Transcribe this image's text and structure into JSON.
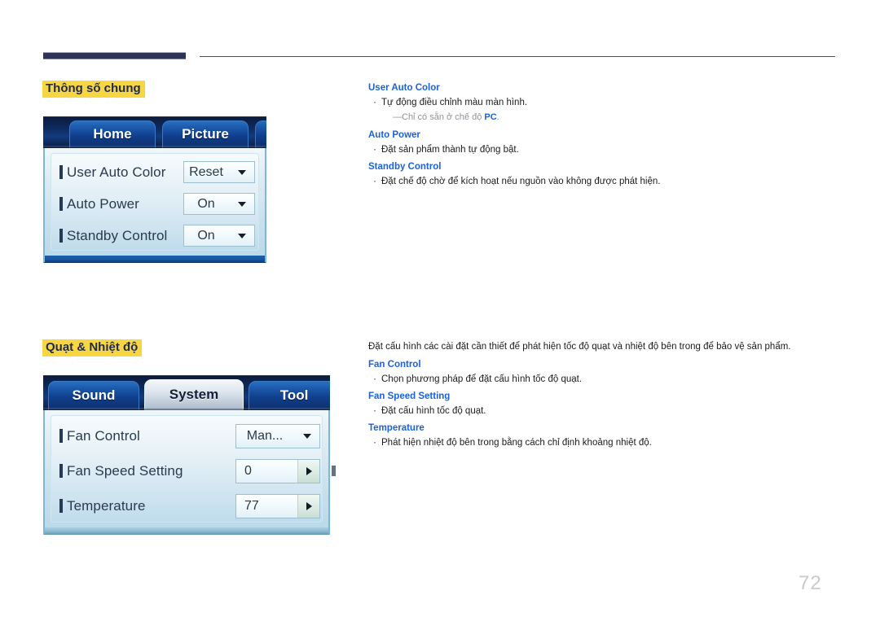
{
  "page": {
    "number": "72"
  },
  "sections": [
    {
      "heading": "Thông số chung",
      "panel": {
        "tabs": [
          {
            "label": "Home",
            "active": false
          },
          {
            "label": "Picture",
            "active": false
          },
          {
            "label": "",
            "active": false
          }
        ],
        "rows": [
          {
            "label": "User Auto Color",
            "value": "Reset",
            "control": "dropdown"
          },
          {
            "label": "Auto Power",
            "value": "On",
            "control": "dropdown"
          },
          {
            "label": "Standby Control",
            "value": "On",
            "control": "dropdown"
          }
        ]
      },
      "text": {
        "items": [
          {
            "title": "User Auto Color",
            "bullet": "Tự động điều chỉnh màu màn hình."
          },
          {
            "title": "Auto Power",
            "bullet": "Đặt sản phẩm thành tự động bật."
          },
          {
            "title": "Standby Control",
            "bullet": "Đặt chế độ chờ để kích hoạt nếu nguồn vào không được phát hiện."
          }
        ],
        "note": {
          "prefix": "Chỉ có sẵn ở chế độ ",
          "keyword": "PC",
          "suffix": "."
        }
      }
    },
    {
      "heading": "Quạt & Nhiệt độ",
      "panel": {
        "tabs": [
          {
            "label": "Sound",
            "active": false
          },
          {
            "label": "System",
            "active": true
          },
          {
            "label": "Tool",
            "active": false
          }
        ],
        "rows": [
          {
            "label": "Fan Control",
            "value": "Man...",
            "control": "dropdown"
          },
          {
            "label": "Fan Speed Setting",
            "value": "0",
            "control": "spinner"
          },
          {
            "label": "Temperature",
            "value": "77",
            "control": "spinner"
          }
        ]
      },
      "text": {
        "intro": "Đặt cấu hình các cài đặt cần thiết để phát hiện tốc độ quạt và nhiệt độ bên trong để bảo vệ sản phẩm.",
        "items": [
          {
            "title": "Fan Control",
            "bullet": "Chọn phương pháp để đặt cấu hình tốc độ quạt."
          },
          {
            "title": "Fan Speed Setting",
            "bullet": "Đặt cấu hình tốc độ quạt."
          },
          {
            "title": "Temperature",
            "bullet": "Phát hiện nhiệt độ bên trong bằng cách chỉ định khoảng nhiệt độ."
          }
        ]
      }
    }
  ],
  "colors": {
    "rule": "#2e3458",
    "highlight": "#f6d743",
    "heading_text": "#222a4f",
    "sub_head": "#1a62e0",
    "body_text": "#1c1c1c",
    "note_text": "#8e9499",
    "page_number": "#c9cacc"
  }
}
